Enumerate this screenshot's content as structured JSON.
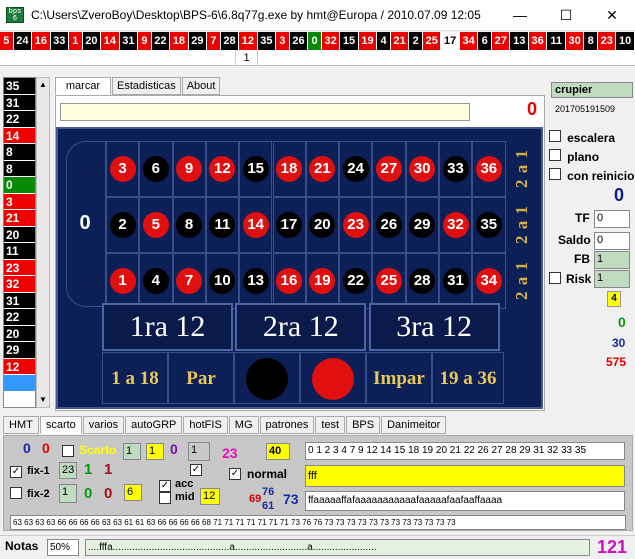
{
  "window": {
    "title": "C:\\Users\\ZveroBoy\\Desktop\\BPS-6\\6.8q77g.exe  by hmt@Europa / 2010.07.09 12:05",
    "minimize": "—",
    "maximize": "☐",
    "close": "✕"
  },
  "history": [
    {
      "n": "5",
      "c": "r"
    },
    {
      "n": "24",
      "c": "b"
    },
    {
      "n": "16",
      "c": "r"
    },
    {
      "n": "33",
      "c": "b"
    },
    {
      "n": "1",
      "c": "r"
    },
    {
      "n": "20",
      "c": "b"
    },
    {
      "n": "14",
      "c": "r"
    },
    {
      "n": "31",
      "c": "b"
    },
    {
      "n": "9",
      "c": "r"
    },
    {
      "n": "22",
      "c": "b"
    },
    {
      "n": "18",
      "c": "r"
    },
    {
      "n": "29",
      "c": "b"
    },
    {
      "n": "7",
      "c": "r"
    },
    {
      "n": "28",
      "c": "b"
    },
    {
      "n": "12",
      "c": "r"
    },
    {
      "n": "35",
      "c": "b"
    },
    {
      "n": "3",
      "c": "r"
    },
    {
      "n": "26",
      "c": "b"
    },
    {
      "n": "0",
      "c": "g"
    },
    {
      "n": "32",
      "c": "r"
    },
    {
      "n": "15",
      "c": "b"
    },
    {
      "n": "19",
      "c": "r"
    },
    {
      "n": "4",
      "c": "b"
    },
    {
      "n": "21",
      "c": "r"
    },
    {
      "n": "2",
      "c": "b"
    },
    {
      "n": "25",
      "c": "r"
    },
    {
      "n": "17",
      "c": "w"
    },
    {
      "n": "34",
      "c": "r"
    },
    {
      "n": "6",
      "c": "b"
    },
    {
      "n": "27",
      "c": "r"
    },
    {
      "n": "13",
      "c": "b"
    },
    {
      "n": "36",
      "c": "r"
    },
    {
      "n": "11",
      "c": "b"
    },
    {
      "n": "30",
      "c": "r"
    },
    {
      "n": "8",
      "c": "b"
    },
    {
      "n": "23",
      "c": "r"
    },
    {
      "n": "10",
      "c": "b"
    }
  ],
  "history_marker": "1",
  "left_list": [
    {
      "n": "35",
      "c": "b"
    },
    {
      "n": "31",
      "c": "b"
    },
    {
      "n": "22",
      "c": "b"
    },
    {
      "n": "14",
      "c": "r"
    },
    {
      "n": "8",
      "c": "b"
    },
    {
      "n": "8",
      "c": "b"
    },
    {
      "n": "0",
      "c": "g"
    },
    {
      "n": "3",
      "c": "r"
    },
    {
      "n": "21",
      "c": "r"
    },
    {
      "n": "20",
      "c": "b"
    },
    {
      "n": "11",
      "c": "b"
    },
    {
      "n": "23",
      "c": "r"
    },
    {
      "n": "32",
      "c": "r"
    },
    {
      "n": "31",
      "c": "b"
    },
    {
      "n": "22",
      "c": "b"
    },
    {
      "n": "20",
      "c": "b"
    },
    {
      "n": "29",
      "c": "b"
    },
    {
      "n": "12",
      "c": "r"
    },
    {
      "n": "",
      "c": "sel"
    }
  ],
  "top_tabs": [
    "marcar",
    "Estadisticas",
    "About"
  ],
  "counter_red": "0",
  "board": {
    "zero": "0",
    "rows": [
      [
        {
          "n": "3",
          "c": "red"
        },
        {
          "n": "6",
          "c": "blk"
        },
        {
          "n": "9",
          "c": "red"
        },
        {
          "n": "12",
          "c": "red"
        },
        {
          "n": "15",
          "c": "blk"
        },
        {
          "n": "18",
          "c": "red"
        },
        {
          "n": "21",
          "c": "red"
        },
        {
          "n": "24",
          "c": "blk"
        },
        {
          "n": "27",
          "c": "red"
        },
        {
          "n": "30",
          "c": "red"
        },
        {
          "n": "33",
          "c": "blk"
        },
        {
          "n": "36",
          "c": "red"
        }
      ],
      [
        {
          "n": "2",
          "c": "blk"
        },
        {
          "n": "5",
          "c": "red"
        },
        {
          "n": "8",
          "c": "blk"
        },
        {
          "n": "11",
          "c": "blk"
        },
        {
          "n": "14",
          "c": "red"
        },
        {
          "n": "17",
          "c": "blk"
        },
        {
          "n": "20",
          "c": "blk"
        },
        {
          "n": "23",
          "c": "red"
        },
        {
          "n": "26",
          "c": "blk"
        },
        {
          "n": "29",
          "c": "blk"
        },
        {
          "n": "32",
          "c": "red"
        },
        {
          "n": "35",
          "c": "blk"
        }
      ],
      [
        {
          "n": "1",
          "c": "red"
        },
        {
          "n": "4",
          "c": "blk"
        },
        {
          "n": "7",
          "c": "red"
        },
        {
          "n": "10",
          "c": "blk"
        },
        {
          "n": "13",
          "c": "blk"
        },
        {
          "n": "16",
          "c": "red"
        },
        {
          "n": "19",
          "c": "red"
        },
        {
          "n": "22",
          "c": "blk"
        },
        {
          "n": "25",
          "c": "red"
        },
        {
          "n": "28",
          "c": "blk"
        },
        {
          "n": "31",
          "c": "blk"
        },
        {
          "n": "34",
          "c": "red"
        }
      ]
    ],
    "columns": [
      "2 a 1",
      "2 a 1",
      "2 a 1"
    ],
    "dozens": [
      "1ra 12",
      "2ra 12",
      "3ra 12"
    ],
    "outside": {
      "low": "1 a 18",
      "even": "Par",
      "odd": "Impar",
      "high": "19 a 36"
    }
  },
  "right": {
    "crupier_label": "crupier",
    "id": "201705191509",
    "checks": [
      "escalera",
      "plano",
      "con reinicio"
    ],
    "big_zero": "0",
    "tf_label": "TF",
    "tf_val": "0",
    "saldo_label": "Saldo",
    "saldo_val": "0",
    "fb_label": "FB",
    "fb_val": "1",
    "risk_label": "Risk",
    "risk_val": "1",
    "yellow": "4",
    "green": "0",
    "blue": "30",
    "red": "575"
  },
  "bottom_tabs": [
    "HMT",
    "scarto",
    "varios",
    "autoGRP",
    "hotFIS",
    "MG",
    "patrones",
    "test",
    "BPS",
    "Danimeitor"
  ],
  "panel": {
    "blue0": "0",
    "red0": "0",
    "scarto": "Scarto",
    "box1": "1",
    "box1y": "1",
    "purple0": "0",
    "box2": "1",
    "magenta": "23",
    "box40": "40",
    "fix1": "fix-1",
    "fix1_box": "23",
    "fix1_g": "1",
    "fix1_r": "1",
    "fix2": "fix-2",
    "fix2_box": "1",
    "fix2_g": "0",
    "fix2_r": "0",
    "fix2_y": "6",
    "acc": "acc",
    "mid": "mid",
    "mid_box": "12",
    "normal": "normal",
    "n69": "69",
    "n76": "76",
    "n61": "61",
    "n73": "73",
    "seq": "0 1 2 3 4 7 9 12 14 15 18 19 20 21 22 26 27 28 29 31 32 33 35",
    "fff": "fff",
    "pattern": "ffaaaaaffafaaaaaaaaaaafaaaaafaafaaffaaaa",
    "strip": "63 63 63 63 66 66 66 66 63 63 61 61 63 66 66 66 66 68 71 71 71 71 71 71 71 73 76 76 73 73 73 73 73 73 73 73 73 73 73 73"
  },
  "status": {
    "notas": "Notas",
    "pct": "50%",
    "progress_text": "....fffa..........................................a..........................a.......................",
    "count": "121"
  }
}
